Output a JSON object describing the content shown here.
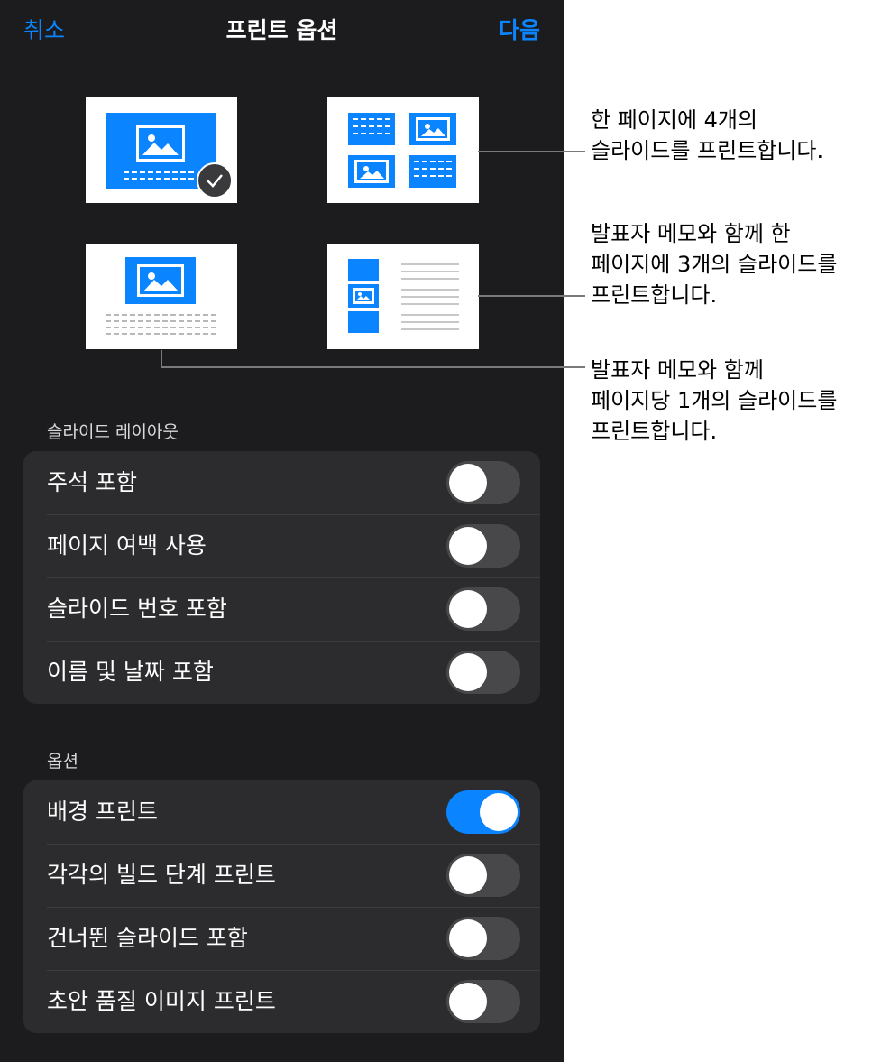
{
  "nav": {
    "cancel": "취소",
    "title": "프린트 옵션",
    "next": "다음"
  },
  "layout_thumbnails": [
    {
      "name": "single-slide",
      "selected": true
    },
    {
      "name": "four-slides-per-page",
      "selected": false
    },
    {
      "name": "slide-with-notes",
      "selected": false
    },
    {
      "name": "three-slides-with-notes",
      "selected": false
    }
  ],
  "slide_layout": {
    "label": "슬라이드 레이아웃",
    "items": [
      {
        "label": "주석 포함",
        "on": false
      },
      {
        "label": "페이지 여백 사용",
        "on": false
      },
      {
        "label": "슬라이드 번호 포함",
        "on": false
      },
      {
        "label": "이름 및 날짜 포함",
        "on": false
      }
    ]
  },
  "options": {
    "label": "옵션",
    "items": [
      {
        "label": "배경 프린트",
        "on": true
      },
      {
        "label": "각각의 빌드 단계 프린트",
        "on": false
      },
      {
        "label": "건너뛴 슬라이드 포함",
        "on": false
      },
      {
        "label": "초안 품질 이미지 프린트",
        "on": false
      }
    ]
  },
  "callouts": [
    {
      "lines": [
        "한 페이지에 4개의",
        "슬라이드를 프린트합니다."
      ]
    },
    {
      "lines": [
        "발표자 메모와 함께 한",
        "페이지에 3개의 슬라이드를",
        "프린트합니다."
      ]
    },
    {
      "lines": [
        "발표자 메모와 함께",
        "페이지당 1개의 슬라이드를",
        "프린트합니다."
      ]
    }
  ],
  "colors": {
    "accent": "#0a84ff",
    "panel": "#1c1c1e",
    "group": "#2c2c2e",
    "toggle_off": "#48484a"
  }
}
